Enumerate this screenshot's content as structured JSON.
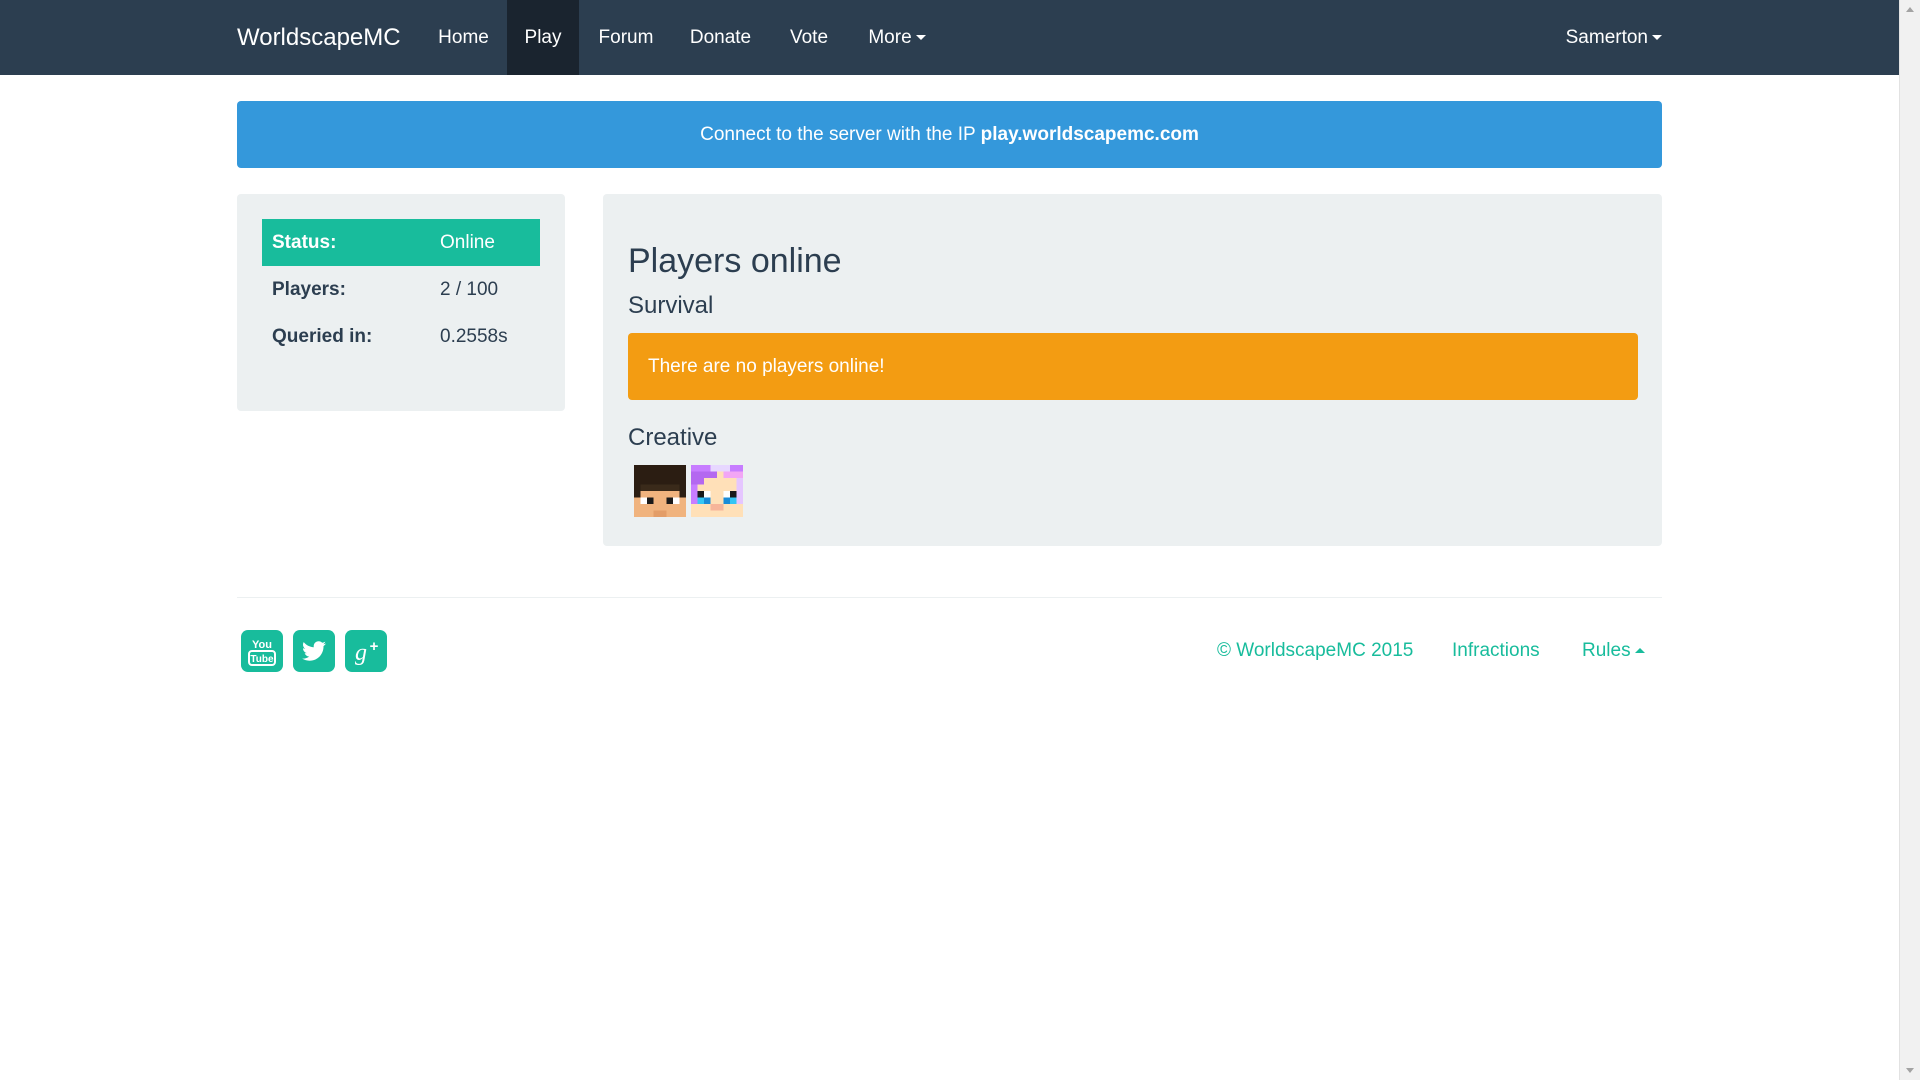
{
  "navbar": {
    "brand": "WorldscapeMC",
    "items": [
      {
        "label": "Home"
      },
      {
        "label": "Play"
      },
      {
        "label": "Forum"
      },
      {
        "label": "Donate"
      },
      {
        "label": "Vote"
      },
      {
        "label": "More"
      }
    ],
    "user": "Samerton"
  },
  "banner": {
    "text": "Connect to the server with the IP ",
    "ip": "play.worldscapemc.com"
  },
  "status": {
    "rows": [
      {
        "key": "Status:",
        "value": "Online"
      },
      {
        "key": "Players:",
        "value": "2 / 100"
      },
      {
        "key": "Queried in:",
        "value": "0.2558s"
      }
    ]
  },
  "players": {
    "title": "Players online",
    "servers": [
      {
        "name": "Survival",
        "alert": "There are no players online!"
      },
      {
        "name": "Creative"
      }
    ]
  },
  "footer": {
    "copyright": "© WorldscapeMC 2015",
    "infractions": "Infractions",
    "rules": "Rules",
    "social": [
      "youtube-icon",
      "twitter-icon",
      "google-plus-icon"
    ]
  },
  "colors": {
    "navbar": "#2c3e50",
    "primary": "#3498db",
    "success": "#18bc9c",
    "warning": "#f39c12",
    "panel": "#ecf0f1"
  }
}
